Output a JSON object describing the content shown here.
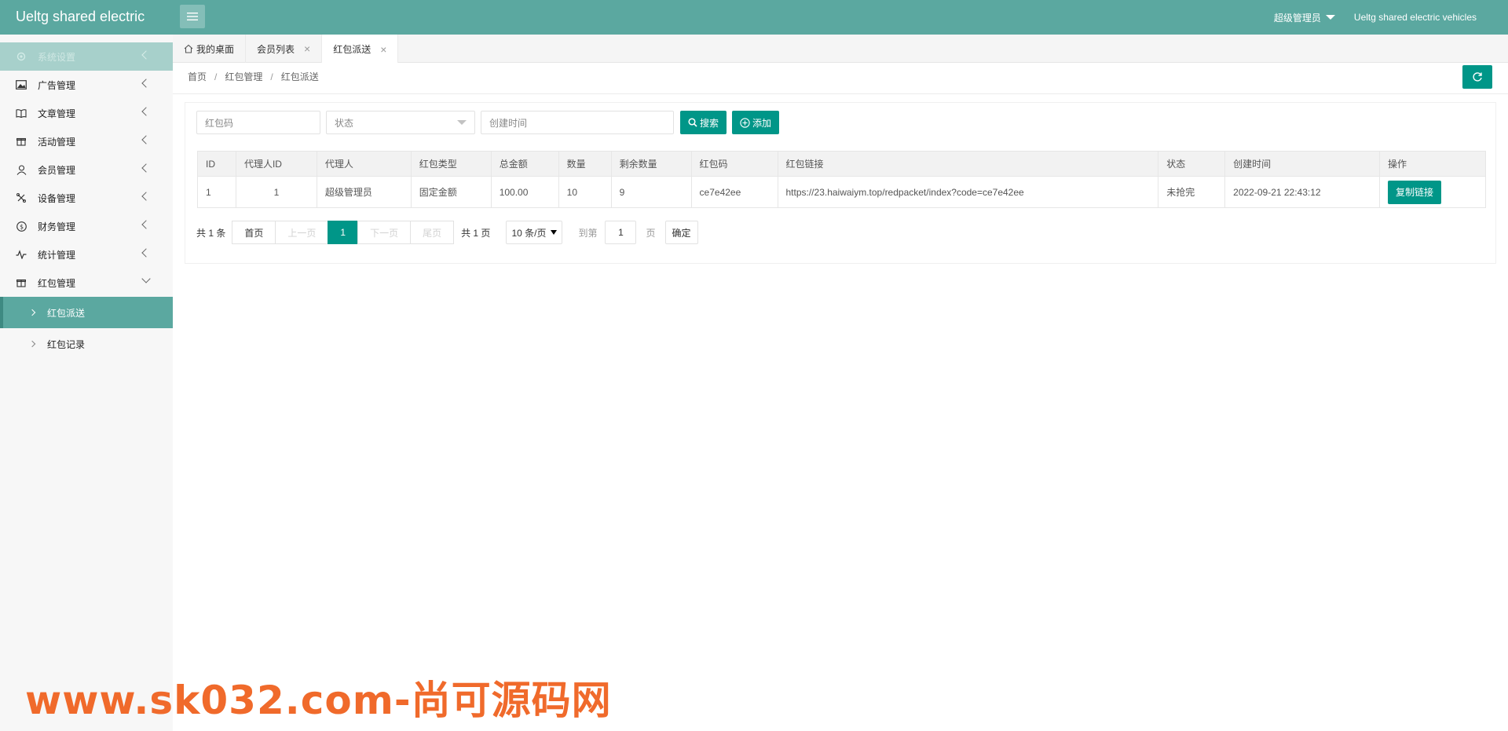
{
  "header": {
    "app_title": "Ueltg shared electric",
    "user_menu": "超级管理员",
    "app_name": "Ueltg shared electric vehicles"
  },
  "sidebar": {
    "items": [
      {
        "label": "系统设置",
        "icon": "gear-icon"
      },
      {
        "label": "广告管理",
        "icon": "image-icon"
      },
      {
        "label": "文章管理",
        "icon": "book-icon"
      },
      {
        "label": "活动管理",
        "icon": "gift-icon"
      },
      {
        "label": "会员管理",
        "icon": "user-icon"
      },
      {
        "label": "设备管理",
        "icon": "tools-icon"
      },
      {
        "label": "财务管理",
        "icon": "dollar-icon"
      },
      {
        "label": "统计管理",
        "icon": "pulse-icon"
      },
      {
        "label": "红包管理",
        "icon": "gift-icon"
      }
    ],
    "sub_items": [
      {
        "label": "红包派送"
      },
      {
        "label": "红包记录"
      }
    ]
  },
  "tabs": [
    {
      "label": "我的桌面"
    },
    {
      "label": "会员列表"
    },
    {
      "label": "红包派送"
    }
  ],
  "breadcrumb": [
    "首页",
    "红包管理",
    "红包派送"
  ],
  "filters": {
    "code_placeholder": "红包码",
    "status_placeholder": "状态",
    "time_placeholder": "创建时间",
    "search_label": "搜索",
    "add_label": "添加"
  },
  "table": {
    "headers": [
      "ID",
      "代理人ID",
      "代理人",
      "红包类型",
      "总金额",
      "数量",
      "剩余数量",
      "红包码",
      "红包链接",
      "状态",
      "创建时间",
      "操作"
    ],
    "rows": [
      {
        "id": "1",
        "agent_id": "1",
        "agent": "超级管理员",
        "type": "固定金额",
        "total": "100.00",
        "count": "10",
        "remaining": "9",
        "code": "ce7e42ee",
        "link": "https://23.haiwaiym.top/redpacket/index?code=ce7e42ee",
        "status": "未抢完",
        "created": "2022-09-21 22:43:12",
        "action": "复制链接"
      }
    ]
  },
  "pager": {
    "total": "共 1 条",
    "first": "首页",
    "prev": "上一页",
    "current": "1",
    "next": "下一页",
    "last": "尾页",
    "pages": "共 1 页",
    "per_page": "10 条/页",
    "goto": "到第",
    "goto_value": "1",
    "page_unit": "页",
    "confirm": "确定"
  },
  "watermark": "www.sk032.com-尚可源码网",
  "colors": {
    "header": "#5ba8a0",
    "primary": "#009688",
    "danger": "#ff5722"
  }
}
